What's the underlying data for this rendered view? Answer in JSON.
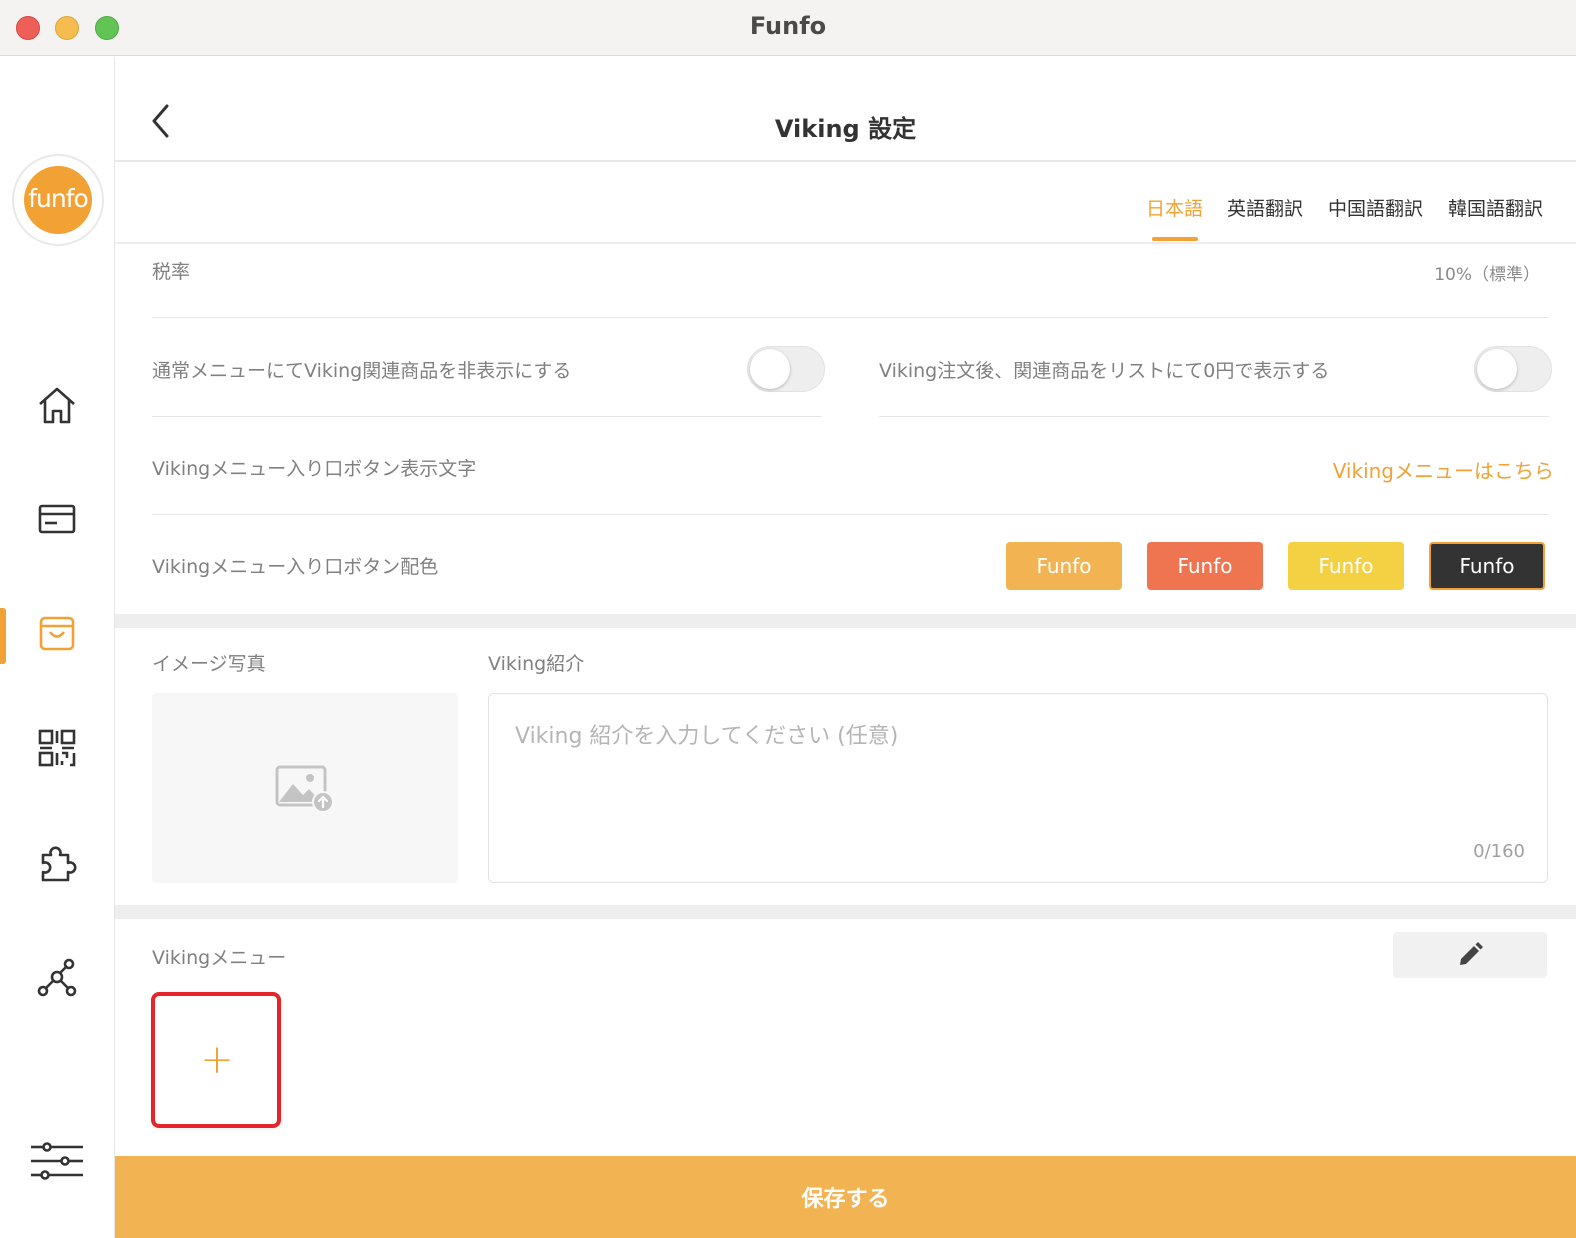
{
  "window": {
    "title": "Funfo"
  },
  "sidebar": {
    "logo_text": "funfo",
    "items": [
      {
        "name": "home",
        "icon": "home-icon",
        "active": false
      },
      {
        "name": "orders",
        "icon": "card-icon",
        "active": false
      },
      {
        "name": "menu",
        "icon": "shopping-bag-icon",
        "active": true
      },
      {
        "name": "qr",
        "icon": "qr-code-icon",
        "active": false
      },
      {
        "name": "plugins",
        "icon": "puzzle-icon",
        "active": false
      },
      {
        "name": "connections",
        "icon": "network-icon",
        "active": false
      },
      {
        "name": "settings",
        "icon": "sliders-icon",
        "active": false
      }
    ]
  },
  "header": {
    "title": "Viking 設定"
  },
  "languages": {
    "tabs": [
      "日本語",
      "英語翻訳",
      "中国語翻訳",
      "韓国語翻訳"
    ],
    "active_index": 0
  },
  "tax": {
    "label": "税率",
    "value": "10%（標準）"
  },
  "toggles": {
    "hide_label": "通常メニューにてViking関連商品を非表示にする",
    "hide_on": false,
    "zero_label": "Viking注文後、関連商品をリストにて0円で表示する",
    "zero_on": false
  },
  "entry_button": {
    "text_label": "Vikingメニュー入り口ボタン表示文字",
    "text_value": "Vikingメニューはこちら",
    "color_label": "Vikingメニュー入り口ボタン配色",
    "swatch_text": "Funfo",
    "swatches": [
      {
        "color": "#f2b352",
        "selected": false
      },
      {
        "color": "#ee7550",
        "selected": false
      },
      {
        "color": "#f3d143",
        "selected": false
      },
      {
        "color": "#333333",
        "selected": true
      }
    ]
  },
  "intro": {
    "image_label": "イメージ写真",
    "intro_label": "Viking紹介",
    "placeholder": "Viking 紹介を入力してください (任意)",
    "value": "",
    "counter": "0/160"
  },
  "viking_menu": {
    "label": "Vikingメニュー",
    "add_symbol": "+"
  },
  "save": {
    "label": "保存する"
  },
  "colors": {
    "accent": "#f2a134",
    "save_bg": "#f2b352",
    "highlight": "#e4262a"
  }
}
